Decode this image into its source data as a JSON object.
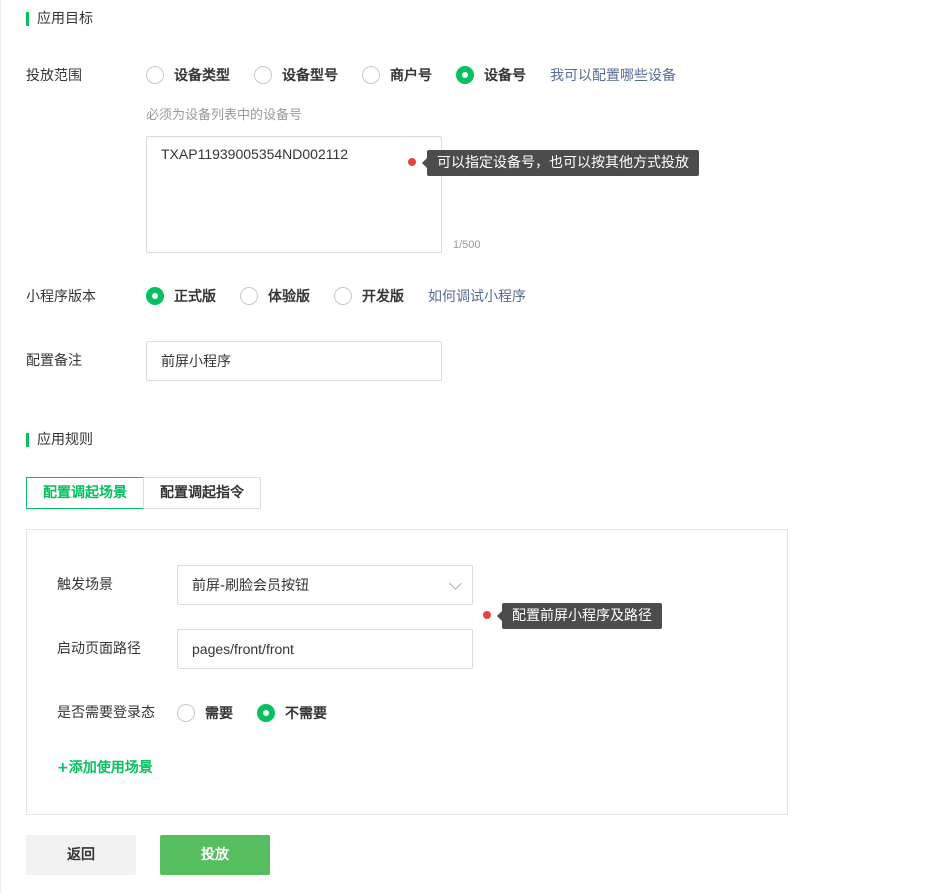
{
  "app_target": {
    "section_title": "应用目标",
    "scope": {
      "label": "投放范围",
      "options": [
        "设备类型",
        "设备型号",
        "商户号",
        "设备号"
      ],
      "selected_index": 3,
      "help_link": "我可以配置哪些设备",
      "hint": "必须为设备列表中的设备号",
      "device_value": "TXAP11939005354ND002112",
      "counter": "1/500",
      "tooltip": "可以指定设备号，也可以按其他方式投放"
    },
    "version": {
      "label": "小程序版本",
      "options": [
        "正式版",
        "体验版",
        "开发版"
      ],
      "selected_index": 0,
      "help_link": "如何调试小程序"
    },
    "remark": {
      "label": "配置备注",
      "value": "前屏小程序"
    }
  },
  "app_rules": {
    "section_title": "应用规则",
    "tabs": [
      "配置调起场景",
      "配置调起指令"
    ],
    "active_tab": 0,
    "trigger": {
      "label": "触发场景",
      "value": "前屏-刷脸会员按钮"
    },
    "path": {
      "label": "启动页面路径",
      "value": "pages/front/front"
    },
    "tooltip": "配置前屏小程序及路径",
    "login": {
      "label": "是否需要登录态",
      "options": [
        "需要",
        "不需要"
      ],
      "selected_index": 1
    },
    "add_scene": "+添加使用场景"
  },
  "footer": {
    "back_label": "返回",
    "submit_label": "投放"
  },
  "colors": {
    "accent": "#07c160",
    "link": "#576b95",
    "tooltip_bg": "#4c4c4c",
    "tooltip_dot": "#e64340"
  }
}
